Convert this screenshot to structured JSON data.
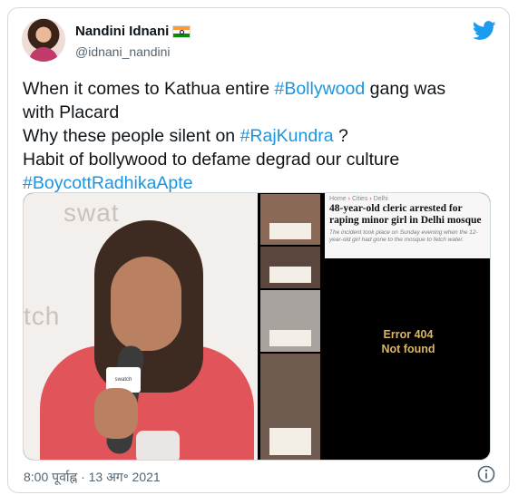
{
  "author": {
    "display_name": "Nandini Idnani",
    "handle": "@idnani_nandini",
    "flag_icon": "india-flag-icon"
  },
  "platform_icon": "twitter-bird-icon",
  "colors": {
    "link": "#1b95e0",
    "bird": "#1d9bf0",
    "muted": "#536471"
  },
  "tweet": {
    "lines": [
      {
        "text": "When it comes to Kathua entire ",
        "tag": "#Bollywood",
        "after": " gang was"
      },
      {
        "text": "with Placard",
        "tag": "",
        "after": ""
      },
      {
        "text": "Why these people silent on ",
        "tag": "#RajKundra",
        "after": " ?"
      },
      {
        "text": "Habit of bollywood to defame degrad our culture",
        "tag": "",
        "after": ""
      },
      {
        "text": "",
        "tag": "#BoycottRadhikaApte",
        "after": ""
      }
    ]
  },
  "media": {
    "left_photo": {
      "brand_text_top": "swat",
      "brand_text_mid": "tch",
      "mic_flag": "swatch"
    },
    "news": {
      "crumb_home": "Home",
      "crumb_cities": "Cities",
      "crumb_delhi": "Delhi",
      "headline": "48-year-old cleric arrested for raping minor girl in Delhi mosque",
      "summary": "The incident took place on Sunday evening when the 12-year-old girl had gone to the mosque to fetch water."
    },
    "error_line1": "Error 404",
    "error_line2": "Not found"
  },
  "timestamp": "8:00 पूर्वाह्न · 13 अग॰ 2021",
  "info_icon": "info-icon"
}
